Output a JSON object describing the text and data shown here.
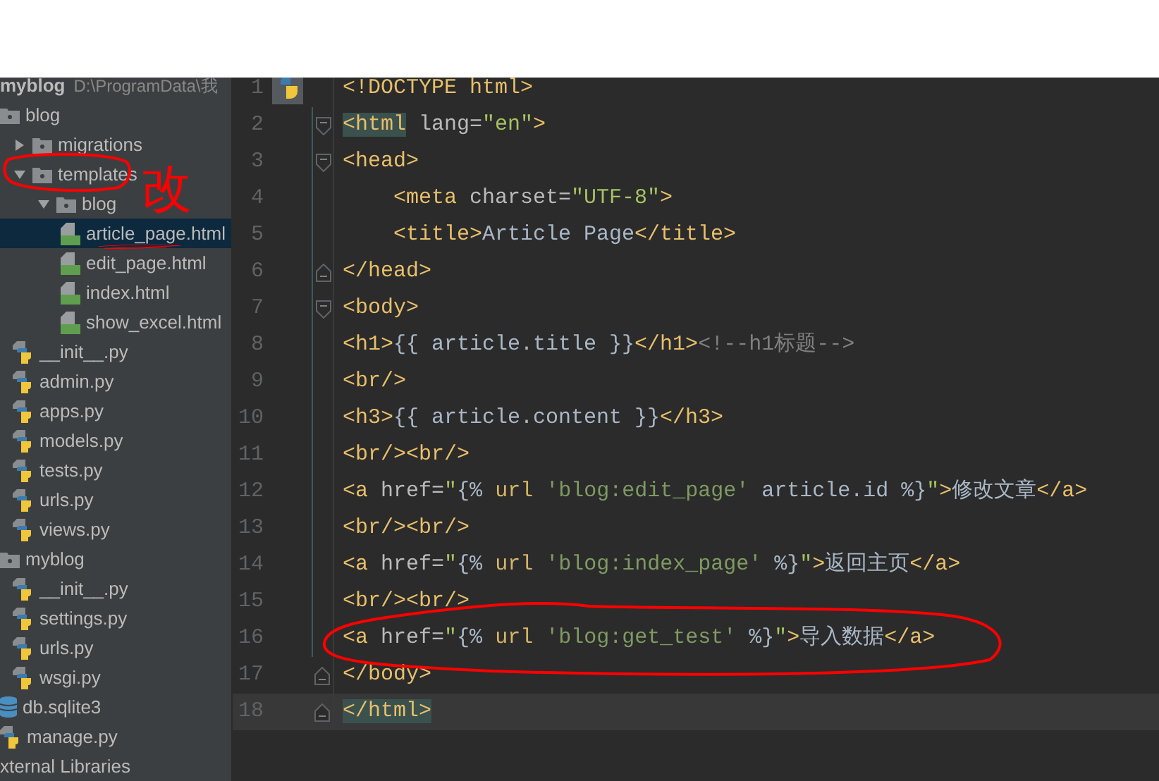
{
  "project_header": {
    "name": "myblog",
    "path": "D:\\ProgramData\\我"
  },
  "tree": [
    {
      "label": "blog",
      "kind": "folder",
      "selected": false,
      "children": [
        {
          "label": "migrations",
          "kind": "folder",
          "expanded": false,
          "selected": false
        },
        {
          "label": "templates",
          "kind": "folder",
          "expanded": true,
          "selected": false,
          "children": [
            {
              "label": "blog",
              "kind": "folder",
              "expanded": true,
              "selected": false,
              "children": [
                {
                  "label": "article_page.html",
                  "kind": "html",
                  "selected": true
                },
                {
                  "label": "edit_page.html",
                  "kind": "html",
                  "selected": false
                },
                {
                  "label": "index.html",
                  "kind": "html",
                  "selected": false
                },
                {
                  "label": "show_excel.html",
                  "kind": "html",
                  "selected": false
                }
              ]
            }
          ]
        },
        {
          "label": "__init__.py",
          "kind": "python",
          "selected": false
        },
        {
          "label": "admin.py",
          "kind": "python",
          "selected": false
        },
        {
          "label": "apps.py",
          "kind": "python",
          "selected": false
        },
        {
          "label": "models.py",
          "kind": "python",
          "selected": false
        },
        {
          "label": "tests.py",
          "kind": "python",
          "selected": false
        },
        {
          "label": "urls.py",
          "kind": "python",
          "selected": false
        },
        {
          "label": "views.py",
          "kind": "python",
          "selected": false
        }
      ]
    },
    {
      "label": "myblog",
      "kind": "folder",
      "selected": false,
      "children": [
        {
          "label": "__init__.py",
          "kind": "python",
          "selected": false
        },
        {
          "label": "settings.py",
          "kind": "python",
          "selected": false
        },
        {
          "label": "urls.py",
          "kind": "python",
          "selected": false
        },
        {
          "label": "wsgi.py",
          "kind": "python",
          "selected": false
        }
      ]
    },
    {
      "label": "db.sqlite3",
      "kind": "database",
      "selected": false
    },
    {
      "label": "manage.py",
      "kind": "python",
      "selected": false
    },
    {
      "label": "xternal Libraries",
      "kind": "library",
      "selected": false
    }
  ],
  "code_lines": [
    {
      "number": "1",
      "current": false,
      "kind": "plain",
      "segments": [
        {
          "kind": "tag",
          "text": "<!DOCTYPE html>"
        }
      ]
    },
    {
      "number": "2",
      "current": false,
      "kind": "fold_start",
      "segments": [
        {
          "kind": "tag_matched",
          "text": "<html"
        },
        {
          "kind": "attr",
          "text": " lang="
        },
        {
          "kind": "string",
          "text": "\"en\""
        },
        {
          "kind": "tag",
          "text": ">"
        }
      ]
    },
    {
      "number": "3",
      "current": false,
      "kind": "fold_start",
      "segments": [
        {
          "kind": "tag",
          "text": "<head>"
        }
      ]
    },
    {
      "number": "4",
      "current": false,
      "kind": "plain",
      "indented": true,
      "segments": [
        {
          "kind": "tag",
          "text": "<meta"
        },
        {
          "kind": "attr",
          "text": " charset="
        },
        {
          "kind": "string",
          "text": "\"UTF-8\""
        },
        {
          "kind": "tag",
          "text": ">"
        }
      ]
    },
    {
      "number": "5",
      "current": false,
      "kind": "plain",
      "indented": true,
      "segments": [
        {
          "kind": "tag",
          "text": "<title>"
        },
        {
          "kind": "text",
          "text": "Article Page"
        },
        {
          "kind": "tag",
          "text": "</title>"
        }
      ]
    },
    {
      "number": "6",
      "current": false,
      "kind": "fold_end",
      "segments": [
        {
          "kind": "tag",
          "text": "</head>"
        }
      ]
    },
    {
      "number": "7",
      "current": false,
      "kind": "fold_start",
      "segments": [
        {
          "kind": "tag",
          "text": "<body>"
        }
      ]
    },
    {
      "number": "8",
      "current": false,
      "kind": "plain",
      "segments": [
        {
          "kind": "tag",
          "text": "<h1>"
        },
        {
          "kind": "text",
          "text": "{{ article.title }}"
        },
        {
          "kind": "tag",
          "text": "</h1>"
        },
        {
          "kind": "comment",
          "text": "<!--h1标题-->"
        }
      ]
    },
    {
      "number": "9",
      "current": false,
      "kind": "plain",
      "segments": [
        {
          "kind": "tag",
          "text": "<br/>"
        }
      ]
    },
    {
      "number": "10",
      "current": false,
      "kind": "plain",
      "segments": [
        {
          "kind": "tag",
          "text": "<h3>"
        },
        {
          "kind": "text",
          "text": "{{ article.content }}"
        },
        {
          "kind": "tag",
          "text": "</h3>"
        }
      ]
    },
    {
      "number": "11",
      "current": false,
      "kind": "plain",
      "segments": [
        {
          "kind": "tag",
          "text": "<br/><br/>"
        }
      ]
    },
    {
      "number": "12",
      "current": false,
      "kind": "plain",
      "segments": [
        {
          "kind": "tag",
          "text": "<a"
        },
        {
          "kind": "attr",
          "text": " href="
        },
        {
          "kind": "string",
          "text": "\""
        },
        {
          "kind": "text",
          "text": "{%"
        },
        {
          "kind": "keyword",
          "text": " url "
        },
        {
          "kind": "template_string",
          "text": "'blog:edit_page'"
        },
        {
          "kind": "text",
          "text": " article.id %}"
        },
        {
          "kind": "string",
          "text": "\""
        },
        {
          "kind": "tag",
          "text": ">"
        },
        {
          "kind": "text",
          "text": "修改文章"
        },
        {
          "kind": "tag",
          "text": "</a>"
        }
      ]
    },
    {
      "number": "13",
      "current": false,
      "kind": "plain",
      "segments": [
        {
          "kind": "tag",
          "text": "<br/><br/>"
        }
      ]
    },
    {
      "number": "14",
      "current": false,
      "kind": "plain",
      "segments": [
        {
          "kind": "tag",
          "text": "<a"
        },
        {
          "kind": "attr",
          "text": " href="
        },
        {
          "kind": "string",
          "text": "\""
        },
        {
          "kind": "text",
          "text": "{%"
        },
        {
          "kind": "keyword",
          "text": " url "
        },
        {
          "kind": "template_string",
          "text": "'blog:index_page'"
        },
        {
          "kind": "text",
          "text": " %}"
        },
        {
          "kind": "string",
          "text": "\""
        },
        {
          "kind": "tag",
          "text": ">"
        },
        {
          "kind": "text",
          "text": "返回主页"
        },
        {
          "kind": "tag",
          "text": "</a>"
        }
      ]
    },
    {
      "number": "15",
      "current": false,
      "kind": "plain",
      "segments": [
        {
          "kind": "tag",
          "text": "<br/><br/>"
        }
      ]
    },
    {
      "number": "16",
      "current": false,
      "kind": "plain",
      "segments": [
        {
          "kind": "tag",
          "text": "<a"
        },
        {
          "kind": "attr",
          "text": " href="
        },
        {
          "kind": "string",
          "text": "\""
        },
        {
          "kind": "text",
          "text": "{%"
        },
        {
          "kind": "keyword",
          "text": " url "
        },
        {
          "kind": "template_string",
          "text": "'blog:get_test'"
        },
        {
          "kind": "text",
          "text": " %}"
        },
        {
          "kind": "string",
          "text": "\""
        },
        {
          "kind": "tag",
          "text": ">"
        },
        {
          "kind": "text",
          "text": "导入数据"
        },
        {
          "kind": "tag",
          "text": "</a>"
        }
      ]
    },
    {
      "number": "17",
      "current": false,
      "kind": "fold_end",
      "segments": [
        {
          "kind": "tag",
          "text": "</body>"
        }
      ]
    },
    {
      "number": "18",
      "current": true,
      "kind": "fold_end",
      "segments": [
        {
          "kind": "tag_matched",
          "text": "</html>"
        }
      ]
    }
  ],
  "annotation": {
    "text": "改"
  }
}
